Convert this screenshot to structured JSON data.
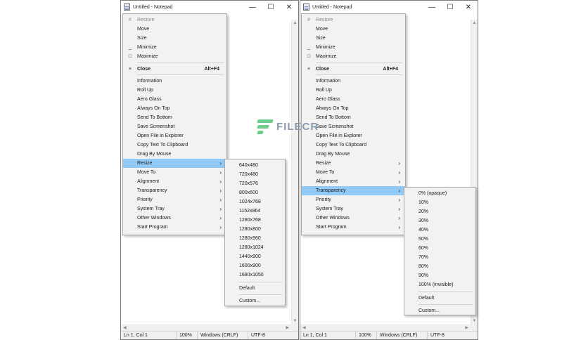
{
  "windows": [
    {
      "title": "Untitled - Notepad",
      "controls": {
        "minimize": "—",
        "maximize": "☐",
        "close": "✕"
      },
      "status": {
        "position": "Ln 1, Col 1",
        "zoom": "100%",
        "eol": "Windows (CRLF)",
        "encoding": "UTF-8"
      },
      "system_menu": {
        "items": [
          {
            "label": "Restore",
            "icon": "restore-icon",
            "glyph": "#",
            "disabled": true
          },
          {
            "label": "Move"
          },
          {
            "label": "Size"
          },
          {
            "label": "Minimize",
            "icon": "minimize-icon",
            "glyph": "_"
          },
          {
            "label": "Maximize",
            "icon": "maximize-icon",
            "glyph": "□"
          },
          {
            "label": "Close",
            "icon": "close-icon",
            "glyph": "×",
            "accel": "Alt+F4",
            "bold": true
          },
          {
            "label": "Information"
          },
          {
            "label": "Roll Up"
          },
          {
            "label": "Aero Glass"
          },
          {
            "label": "Always On Top"
          },
          {
            "label": "Send To Bottom"
          },
          {
            "label": "Save Screenshot"
          },
          {
            "label": "Open File in Explorer"
          },
          {
            "label": "Copy Text To Clipboard"
          },
          {
            "label": "Drag By Mouse"
          },
          {
            "label": "Resize",
            "submenu": true,
            "highlighted": true
          },
          {
            "label": "Move To",
            "submenu": true
          },
          {
            "label": "Alignment",
            "submenu": true
          },
          {
            "label": "Transparency",
            "submenu": true
          },
          {
            "label": "Priority",
            "submenu": true
          },
          {
            "label": "System Tray",
            "submenu": true
          },
          {
            "label": "Other Windows",
            "submenu": true
          },
          {
            "label": "Start Program",
            "submenu": true
          }
        ]
      },
      "submenu": {
        "items": [
          "640x480",
          "720x480",
          "720x576",
          "800x600",
          "1024x768",
          "1152x864",
          "1280x768",
          "1280x800",
          "1280x960",
          "1280x1024",
          "1440x900",
          "1600x900",
          "1680x1050",
          "Default",
          "Custom..."
        ]
      }
    },
    {
      "title": "Untitled - Notepad",
      "controls": {
        "minimize": "—",
        "maximize": "☐",
        "close": "✕"
      },
      "status": {
        "position": "Ln 1, Col 1",
        "zoom": "100%",
        "eol": "Windows (CRLF)",
        "encoding": "UTF-8"
      },
      "system_menu": {
        "items": [
          {
            "label": "Restore",
            "icon": "restore-icon",
            "glyph": "#",
            "disabled": true
          },
          {
            "label": "Move"
          },
          {
            "label": "Size"
          },
          {
            "label": "Minimize",
            "icon": "minimize-icon",
            "glyph": "_"
          },
          {
            "label": "Maximize",
            "icon": "maximize-icon",
            "glyph": "□"
          },
          {
            "label": "Close",
            "icon": "close-icon",
            "glyph": "×",
            "accel": "Alt+F4",
            "bold": true
          },
          {
            "label": "Information"
          },
          {
            "label": "Roll Up"
          },
          {
            "label": "Aero Glass"
          },
          {
            "label": "Always On Top"
          },
          {
            "label": "Send To Bottom"
          },
          {
            "label": "Save Screenshot"
          },
          {
            "label": "Open File in Explorer"
          },
          {
            "label": "Copy Text To Clipboard"
          },
          {
            "label": "Drag By Mouse"
          },
          {
            "label": "Resize",
            "submenu": true
          },
          {
            "label": "Move To",
            "submenu": true
          },
          {
            "label": "Alignment",
            "submenu": true
          },
          {
            "label": "Transparency",
            "submenu": true,
            "highlighted": true
          },
          {
            "label": "Priority",
            "submenu": true
          },
          {
            "label": "System Tray",
            "submenu": true
          },
          {
            "label": "Other Windows",
            "submenu": true
          },
          {
            "label": "Start Program",
            "submenu": true
          }
        ]
      },
      "submenu": {
        "items": [
          "0% (opaque)",
          "10%",
          "20%",
          "30%",
          "40%",
          "50%",
          "60%",
          "70%",
          "80%",
          "90%",
          "100% (invisible)",
          "Default",
          "Custom..."
        ]
      }
    }
  ],
  "watermark": {
    "text": "FILECR",
    "color": "#6fce8e"
  },
  "colors": {
    "highlight": "#91c9f7",
    "menu_bg": "#f2f2f2",
    "statusbar_bg": "#f0f0f0"
  }
}
